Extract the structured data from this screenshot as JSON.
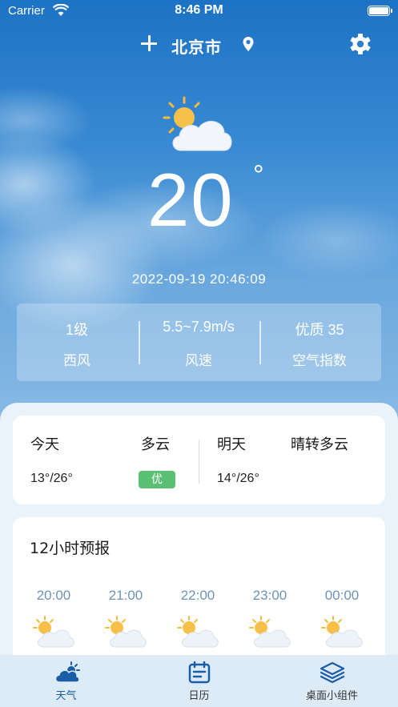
{
  "status_bar": {
    "carrier": "Carrier",
    "time": "8:46 PM"
  },
  "header": {
    "city": "北京市"
  },
  "current": {
    "icon": "partly-cloudy-icon",
    "temperature": "20",
    "degree_symbol": "°",
    "datetime": "2022-09-19 20:46:09"
  },
  "stats": [
    {
      "value": "1级",
      "label": "西风"
    },
    {
      "value": "5.5~7.9m/s",
      "label": "风速"
    },
    {
      "value": "优质 35",
      "label": "空气指数"
    }
  ],
  "today": {
    "label": "今天",
    "condition": "多云",
    "temp": "13°/26°",
    "aqi": "优"
  },
  "tomorrow": {
    "label": "明天",
    "condition": "晴转多云",
    "temp": "14°/26°"
  },
  "hourly": {
    "title": "12小时预报",
    "hours": [
      {
        "time": "20:00",
        "icon": "partly-cloudy-icon"
      },
      {
        "time": "21:00",
        "icon": "partly-cloudy-icon"
      },
      {
        "time": "22:00",
        "icon": "partly-cloudy-icon"
      },
      {
        "time": "23:00",
        "icon": "partly-cloudy-icon"
      },
      {
        "time": "00:00",
        "icon": "partly-cloudy-icon"
      }
    ]
  },
  "tabs": [
    {
      "label": "天气",
      "icon": "weather-icon",
      "active": true
    },
    {
      "label": "日历",
      "icon": "calendar-icon",
      "active": false
    },
    {
      "label": "桌面小组件",
      "icon": "layers-icon",
      "active": false
    }
  ],
  "colors": {
    "accent": "#1b5ea8",
    "aqi_good": "#5ac174",
    "sky_top": "#1c72c4"
  }
}
